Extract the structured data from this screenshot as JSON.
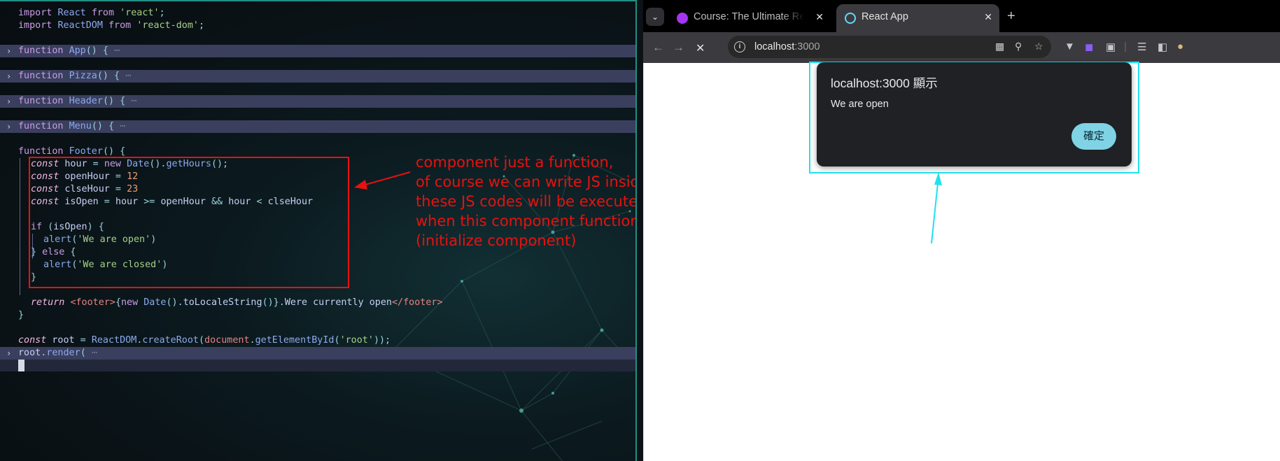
{
  "editor": {
    "lines": {
      "l1": "import React from 'react';",
      "l2": "import ReactDOM from 'react-dom';",
      "fold1": "function App() { ⋯",
      "fold2": "function Pizza() { ⋯",
      "fold3": "function Header() { ⋯",
      "fold4": "function Menu() { ⋯",
      "footer_open": "function Footer() {",
      "hour": "const hour = new Date().getHours();",
      "open_hour": "const openHour = 12",
      "close_hour": "const clseHour = 23",
      "is_open": "const isOpen = hour >= openHour && hour < clseHour",
      "if_line": "if (isOpen) {",
      "alert_open": "alert('We are open')",
      "else_line": "} else {",
      "alert_closed": "alert('We are closed')",
      "close_if": "}",
      "return_line": "return <footer>{new Date().toLocaleString()}.We're currently open</footer>",
      "close_fn": "}",
      "root_line": "const root = ReactDOM.createRoot(document.getElementById('root'));",
      "render_fold": "root.render( ⋯"
    },
    "fold_marker": "›"
  },
  "annotation": {
    "text": "component just a function,\nof course we can write JS inside it,\nthese JS codes will be executed\nwhen this component function is called\n(initialize component)",
    "color": "#e8110f"
  },
  "browser": {
    "tabs": [
      {
        "title": "Course: The Ultimate React",
        "favicon_color": "#a435f0",
        "close": "✕"
      },
      {
        "title": "React App",
        "favicon_color": "#61dafb",
        "close": "✕"
      }
    ],
    "new_tab": "+",
    "tab_search_icon": "chevron-down-icon",
    "nav": {
      "back": "←",
      "forward": "→",
      "stop": "✕"
    },
    "url_host": "localhost",
    "url_port": ":3000",
    "dialog": {
      "title": "localhost:3000 顯示",
      "message": "We are open",
      "ok_label": "確定"
    },
    "highlight_color": "#22e0f0"
  }
}
